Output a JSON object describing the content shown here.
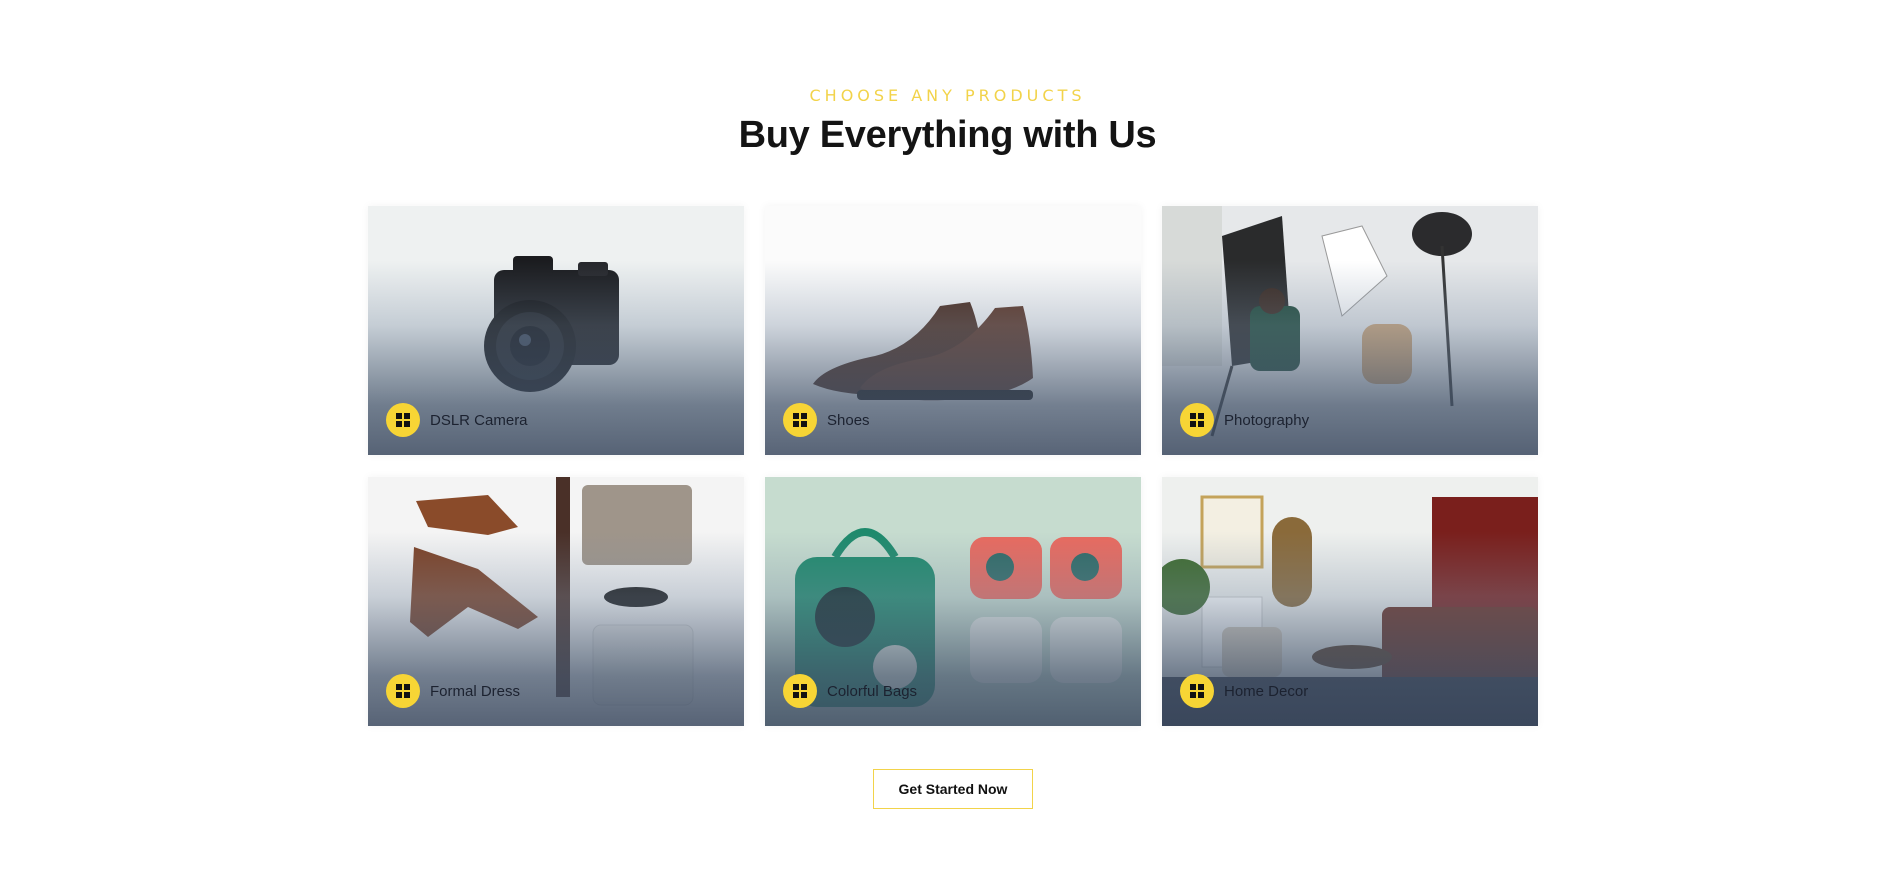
{
  "section": {
    "eyebrow": "CHOOSE ANY PRODUCTS",
    "title": "Buy Everything with Us"
  },
  "products": [
    {
      "label": "DSLR Camera",
      "icon": "windows-icon"
    },
    {
      "label": "Shoes",
      "icon": "windows-icon"
    },
    {
      "label": "Photography",
      "icon": "windows-icon"
    },
    {
      "label": "Formal Dress",
      "icon": "windows-icon"
    },
    {
      "label": "Colorful Bags",
      "icon": "windows-icon"
    },
    {
      "label": "Home Decor",
      "icon": "windows-icon"
    }
  ],
  "cta": {
    "label": "Get Started Now"
  },
  "colors": {
    "accent": "#f7d535",
    "heading": "#141414"
  }
}
